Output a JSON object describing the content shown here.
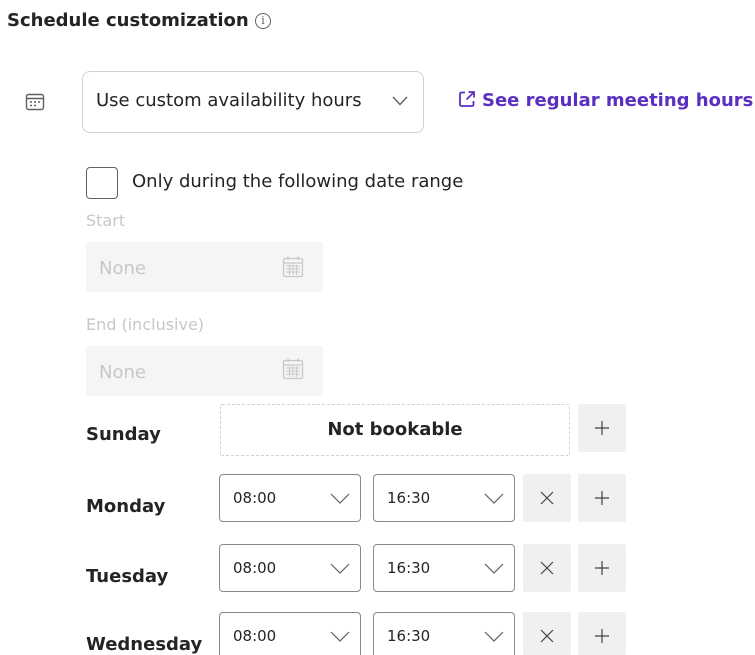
{
  "header": {
    "title": "Schedule customization",
    "info_icon": "info-icon"
  },
  "availability": {
    "calendar_icon": "calendar-icon",
    "mode_value": "Use custom availability hours",
    "chevron_icon": "chevron-down-icon",
    "link_label": "See regular meeting hours",
    "link_icon": "external-link-icon"
  },
  "date_range": {
    "checkbox_label": "Only during the following date range",
    "checked": false,
    "start_label": "Start",
    "start_value": "None",
    "end_label": "End (inclusive)",
    "end_value": "None",
    "field_icon": "calendar-icon"
  },
  "days": [
    {
      "name": "Sunday",
      "bookable": false,
      "status": "Not bookable"
    },
    {
      "name": "Monday",
      "bookable": true,
      "start": "08:00",
      "end": "16:30"
    },
    {
      "name": "Tuesday",
      "bookable": true,
      "start": "08:00",
      "end": "16:30"
    },
    {
      "name": "Wednesday",
      "bookable": true,
      "start": "08:00",
      "end": "16:30"
    }
  ],
  "actions": {
    "remove_icon": "close-icon",
    "add_icon": "plus-icon"
  },
  "colors": {
    "link": "#5b2fc2",
    "text": "#242424",
    "disabled_text": "#c7c7c7",
    "disabled_field_bg": "#f5f5f5",
    "button_bg": "#f0f0f0"
  }
}
